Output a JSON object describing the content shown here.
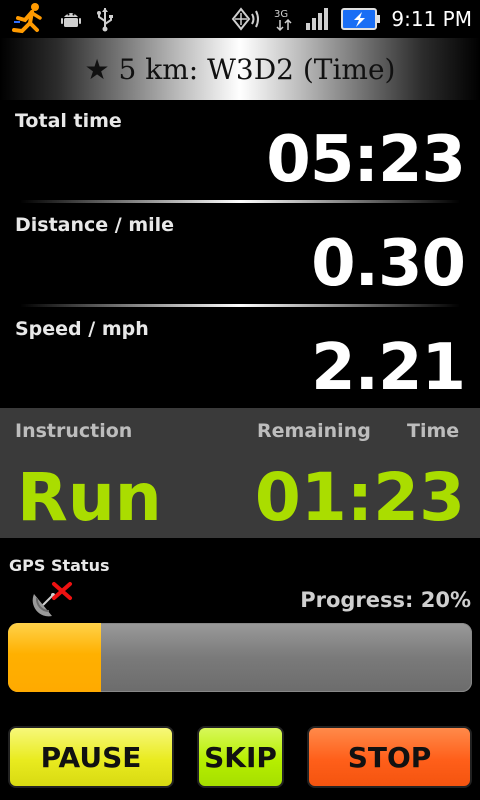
{
  "status_bar": {
    "time": "9:11 PM",
    "network": "3G",
    "icons": [
      "runner-app-icon",
      "android-debug-icon",
      "usb-icon",
      "gps-signal-icon",
      "network-3g-icon",
      "signal-bars-icon",
      "battery-charging-icon"
    ]
  },
  "title": "★ 5 km: W3D2 (Time)",
  "stats": {
    "total_time": {
      "label": "Total time",
      "value": "05:23"
    },
    "distance": {
      "label": "Distance / mile",
      "value": "0.30"
    },
    "speed": {
      "label": "Speed / mph",
      "value": "2.21"
    }
  },
  "instruction": {
    "header_instruction": "Instruction",
    "header_remaining": "Remaining",
    "header_time": "Time",
    "action": "Run",
    "remaining_time": "01:23",
    "color": "#aadd00"
  },
  "gps": {
    "label": "GPS Status",
    "icon": "gps-no-fix-icon"
  },
  "progress": {
    "label": "Progress: 20%",
    "value": 0.2,
    "fill_color": "#ffb000"
  },
  "buttons": {
    "pause": "PAUSE",
    "skip": "SKIP",
    "stop": "STOP"
  }
}
